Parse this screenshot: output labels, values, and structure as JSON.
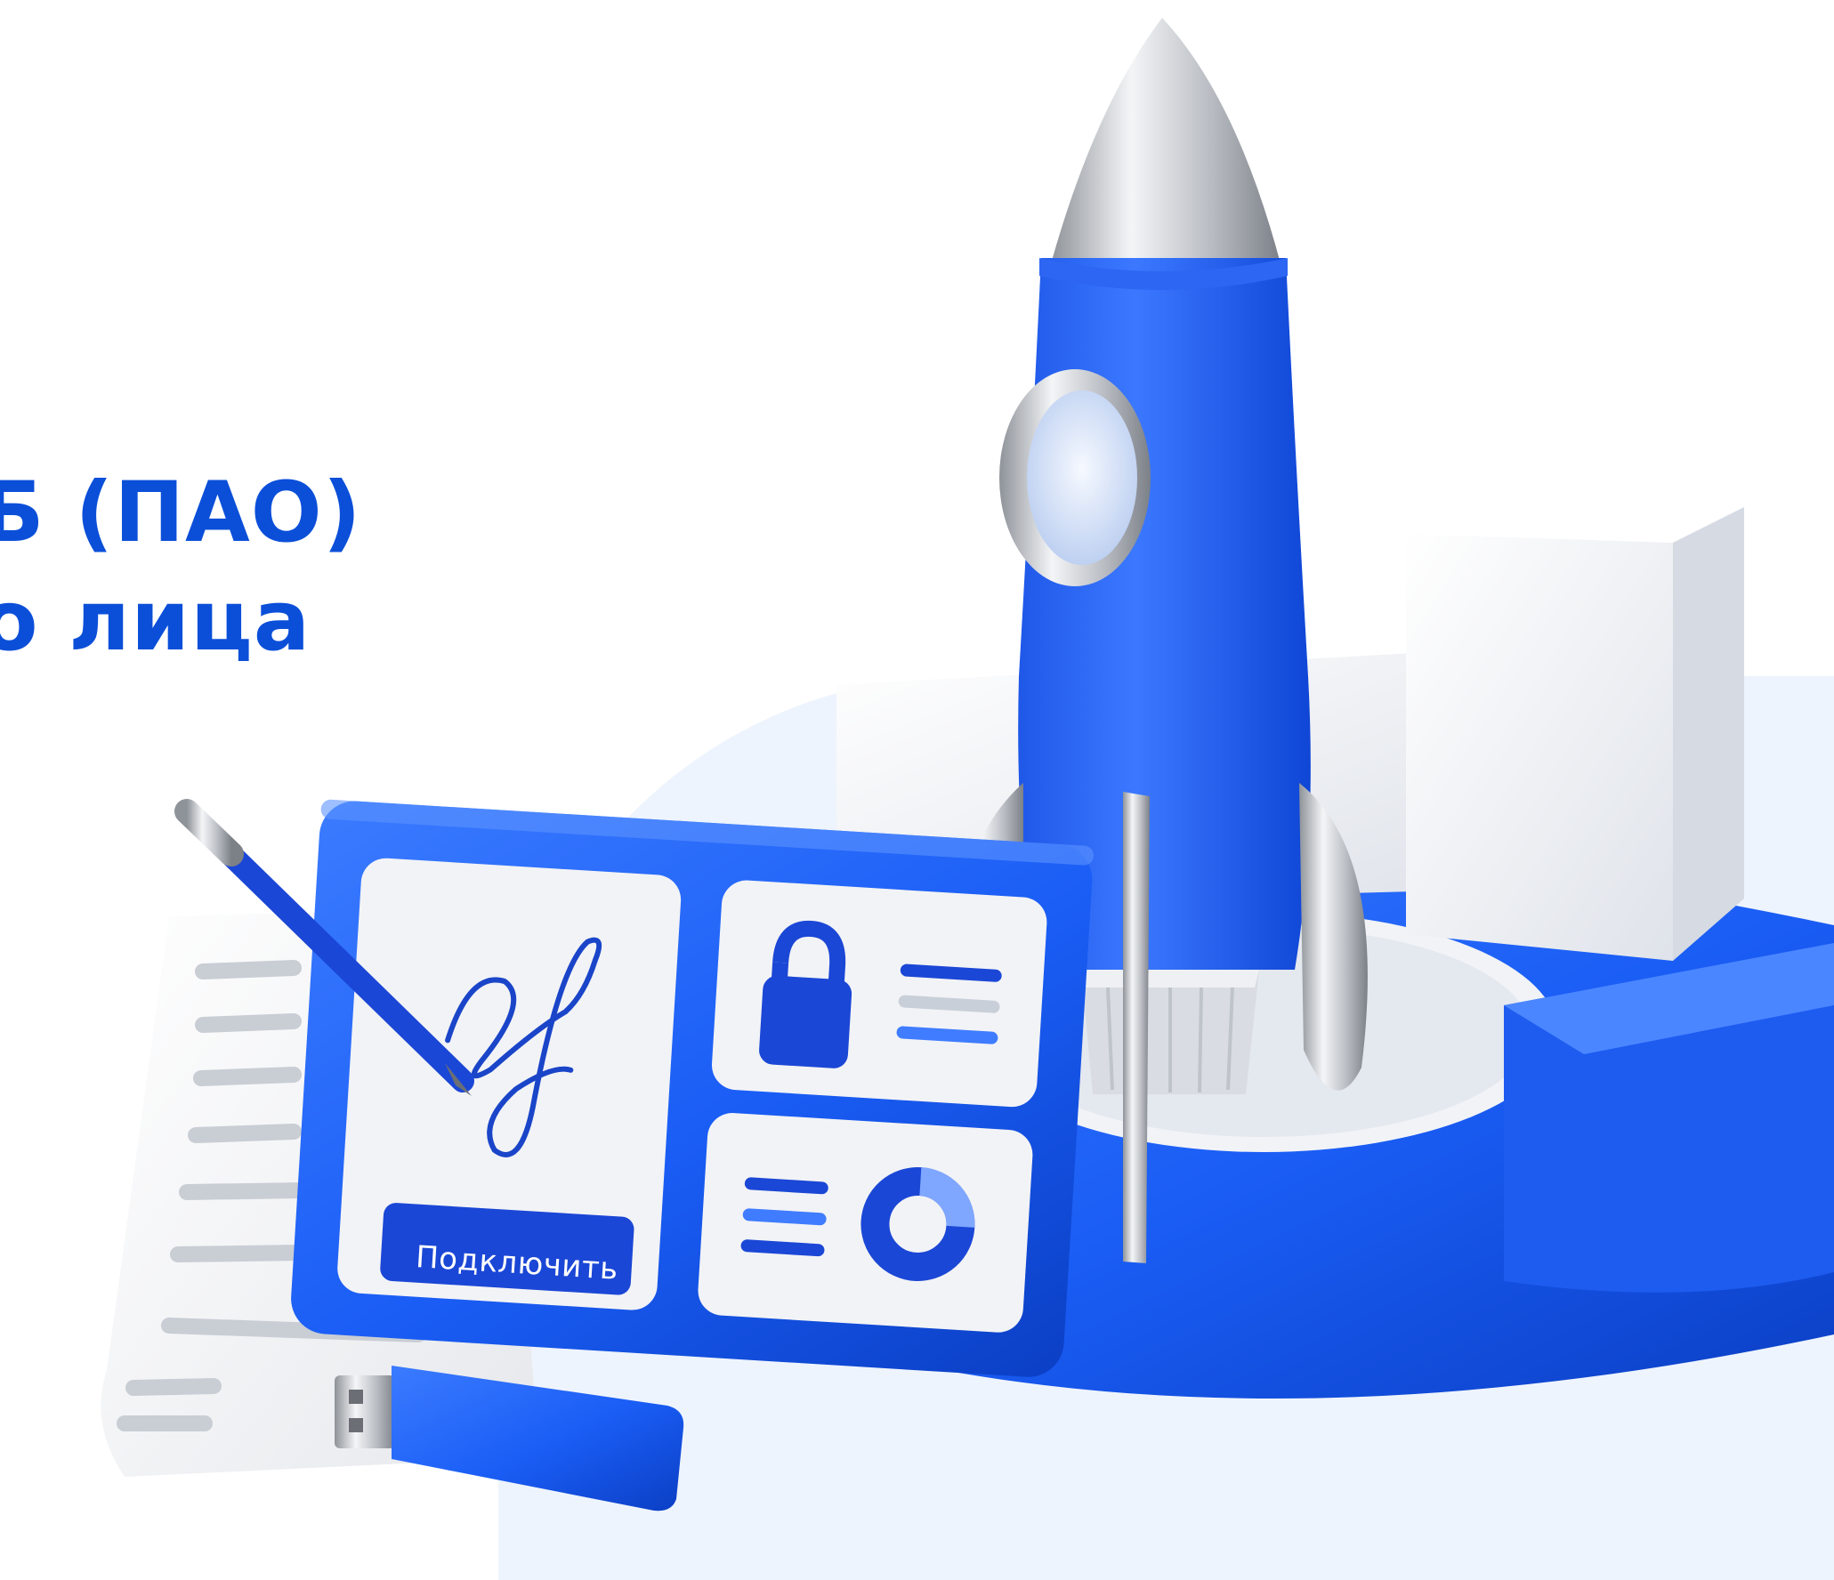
{
  "headline": {
    "line1": "Б (ПАО)",
    "line2": "о лица"
  },
  "panel": {
    "connect_button_label": "Подключить"
  },
  "colors": {
    "brand_blue": "#0b4fd9",
    "accent_blue": "#1a5df5",
    "background_tint": "#eef4fd"
  },
  "icons": [
    "pen-icon",
    "signature-icon",
    "lock-icon",
    "lines-icon",
    "donut-chart-icon",
    "usb-token-icon",
    "rocket-icon",
    "document-icon"
  ]
}
